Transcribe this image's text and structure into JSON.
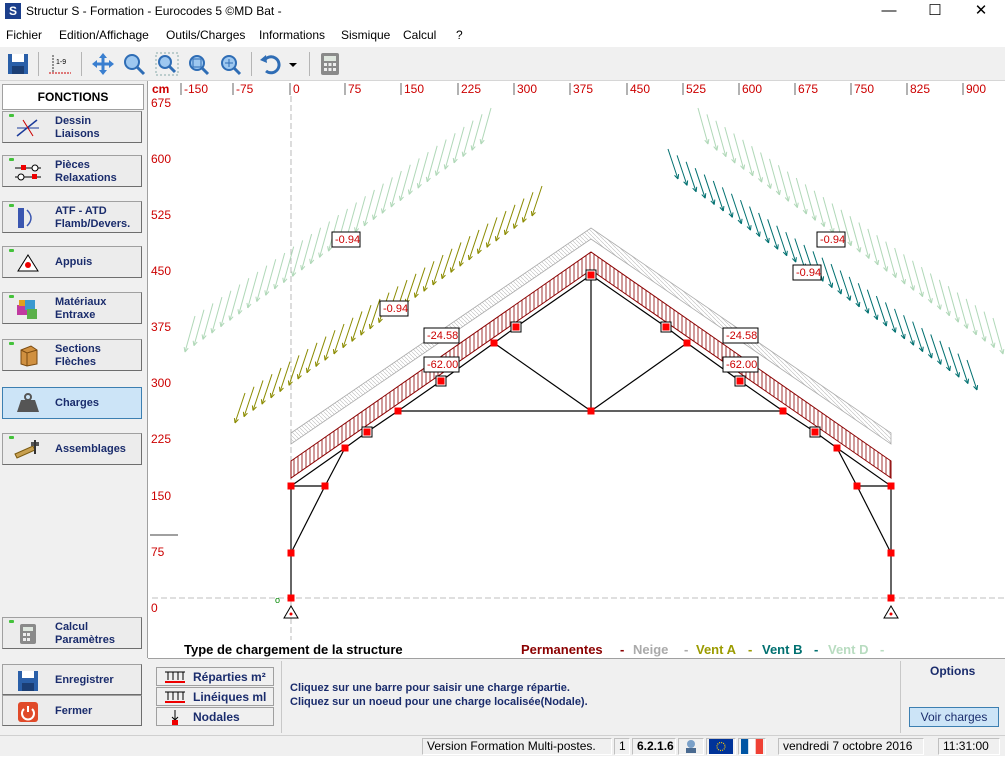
{
  "window": {
    "title": "Structur S - Formation - Eurocodes 5 ©MD Bat -",
    "app_icon": "S",
    "minimize_glyph": "—",
    "maximize_glyph": "☐",
    "close_glyph": "✕"
  },
  "menu": [
    "Fichier",
    "Edition/Affichage",
    "Outils/Charges",
    "Informations",
    "Sismique",
    "Calcul",
    "?"
  ],
  "toolbar": {
    "icons": [
      "save-icon",
      "numbering-icon",
      "pan-icon",
      "zoom-icon",
      "zoom-window-icon",
      "zoom-extents-icon",
      "zoom-fit-icon",
      "undo-icon",
      "dropdown-icon",
      "calculator-icon"
    ],
    "numbering_text": "1-9"
  },
  "left_panel": {
    "title": "FONCTIONS",
    "buttons": [
      {
        "label": "Dessin\nLiaisons",
        "icon": "drawing-icon"
      },
      {
        "label": "Pièces\nRelaxations",
        "icon": "pieces-icon"
      },
      {
        "label": "ATF - ATD\nFlamb/Devers.",
        "icon": "buckling-icon"
      },
      {
        "label": "Appuis",
        "icon": "support-icon"
      },
      {
        "label": "Matériaux\nEntraxe",
        "icon": "materials-icon"
      },
      {
        "label": "Sections\nFlèches",
        "icon": "sections-icon"
      },
      {
        "label": "Charges",
        "icon": "weight-icon"
      },
      {
        "label": "Assemblages",
        "icon": "assembly-icon"
      }
    ],
    "calc_button": "Calcul\nParamètres",
    "save_button": "Enregistrer",
    "close_button": "Fermer"
  },
  "ruler": {
    "unit": "cm",
    "top_ticks": [
      "-150",
      "-75",
      "0",
      "75",
      "150",
      "225",
      "300",
      "375",
      "450",
      "525",
      "600",
      "675",
      "750",
      "825",
      "900"
    ],
    "left_ticks": [
      "675",
      "600",
      "525",
      "450",
      "375",
      "300",
      "225",
      "150",
      "75",
      "0"
    ]
  },
  "drawing": {
    "load_labels": {
      "wind_left_upper": "-0.94",
      "wind_left_lower": "-0.94",
      "wind_right_upper": "-0.94",
      "wind_right_lower": "-0.94",
      "snow_left": "-24.58",
      "snow_right": "-24.58",
      "perm_left": "-62.00",
      "perm_right": "-62.00"
    },
    "origin_marker": "o",
    "colors": {
      "permanent": "#8b0000",
      "snow": "#a9a9a9",
      "wind_a": "#8b8b00",
      "wind_b": "#007070",
      "wind_d": "#b0d8b8",
      "node": "#ff0000"
    }
  },
  "legend": {
    "title": "Type de chargement de la structure",
    "items": [
      {
        "label": "Permanentes",
        "color": "#8b0000"
      },
      {
        "label": "Neige",
        "color": "#a9a9a9"
      },
      {
        "label": "Vent A",
        "color": "#9b9b00"
      },
      {
        "label": "Vent B",
        "color": "#007070"
      },
      {
        "label": "Vent D",
        "color": "#b8dcc0"
      }
    ],
    "separator": "-"
  },
  "bottom": {
    "buttons": [
      "Réparties m²",
      "Linéiques ml",
      "Nodales"
    ],
    "info_lines": [
      "Cliquez sur une barre pour saisir une charge répartie.",
      "Cliquez sur un noeud pour une charge localisée(Nodale)."
    ],
    "options_label": "Options",
    "voir_button": "Voir charges"
  },
  "status": {
    "version_text": "Version Formation Multi-postes.",
    "num": "1",
    "version": "6.2.1.6",
    "date": "vendredi  7  octobre  2016",
    "time": "11:31:00"
  }
}
